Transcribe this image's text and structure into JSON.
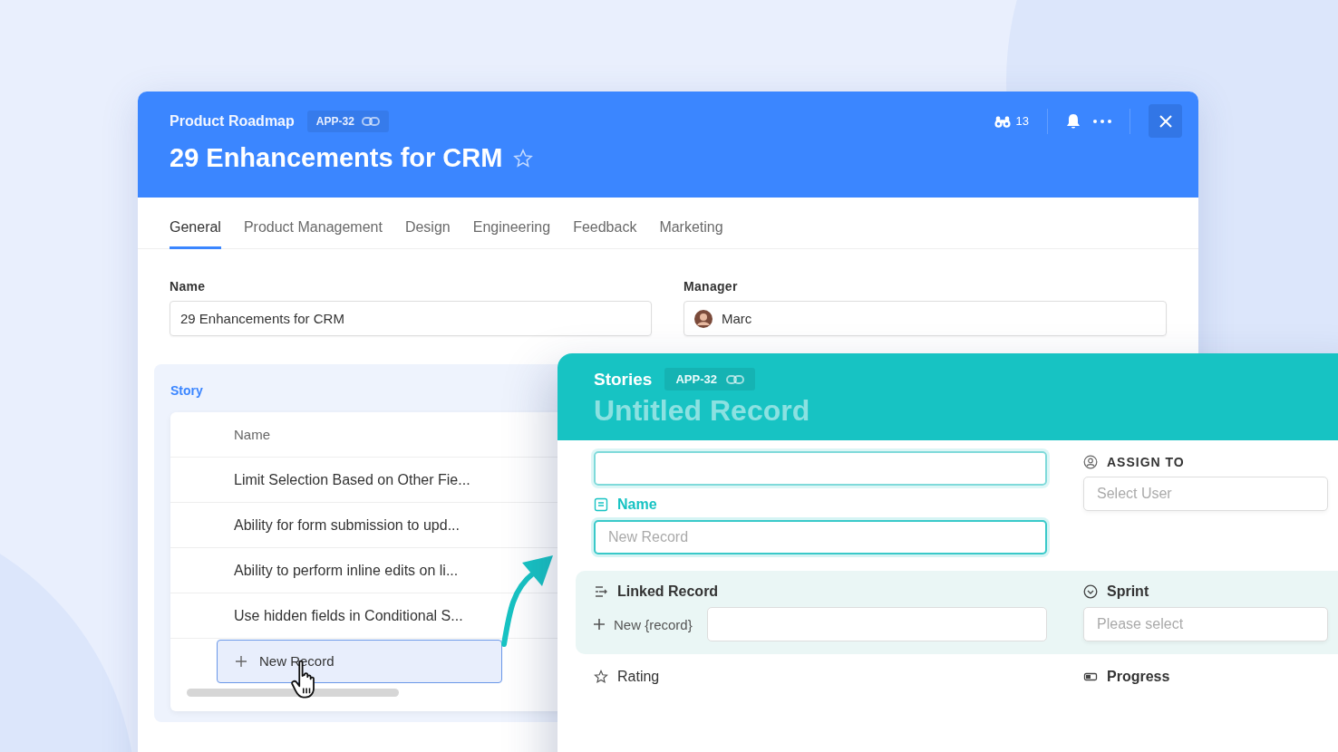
{
  "main_window": {
    "breadcrumb": "Product Roadmap",
    "record_id": "APP-32",
    "title": "29 Enhancements for CRM",
    "watchers": "13"
  },
  "tabs": [
    {
      "label": "General",
      "selected": true
    },
    {
      "label": "Product Management",
      "selected": false
    },
    {
      "label": "Design",
      "selected": false
    },
    {
      "label": "Engineering",
      "selected": false
    },
    {
      "label": "Feedback",
      "selected": false
    },
    {
      "label": "Marketing",
      "selected": false
    }
  ],
  "fields": {
    "name_label": "Name",
    "name_value": "29 Enhancements for CRM",
    "manager_label": "Manager",
    "manager_value": "Marc"
  },
  "story": {
    "label": "Story",
    "column": "Name",
    "rows": [
      "Limit Selection Based on Other Fie...",
      "Ability for form submission to upd...",
      "Ability to perform inline edits on li...",
      "Use hidden fields in Conditional S..."
    ],
    "new_record": "New Record"
  },
  "record_form": {
    "app": "Stories",
    "record_id": "APP-32",
    "title_placeholder": "Untitled Record",
    "name_label": "Name",
    "name_placeholder": "New Record",
    "assign_label": "ASSIGN TO",
    "assign_placeholder": "Select User",
    "linked_label": "Linked Record",
    "linked_add": "New {record}",
    "sprint_label": "Sprint",
    "sprint_placeholder": "Please select",
    "rating_label": "Rating",
    "progress_label": "Progress"
  }
}
